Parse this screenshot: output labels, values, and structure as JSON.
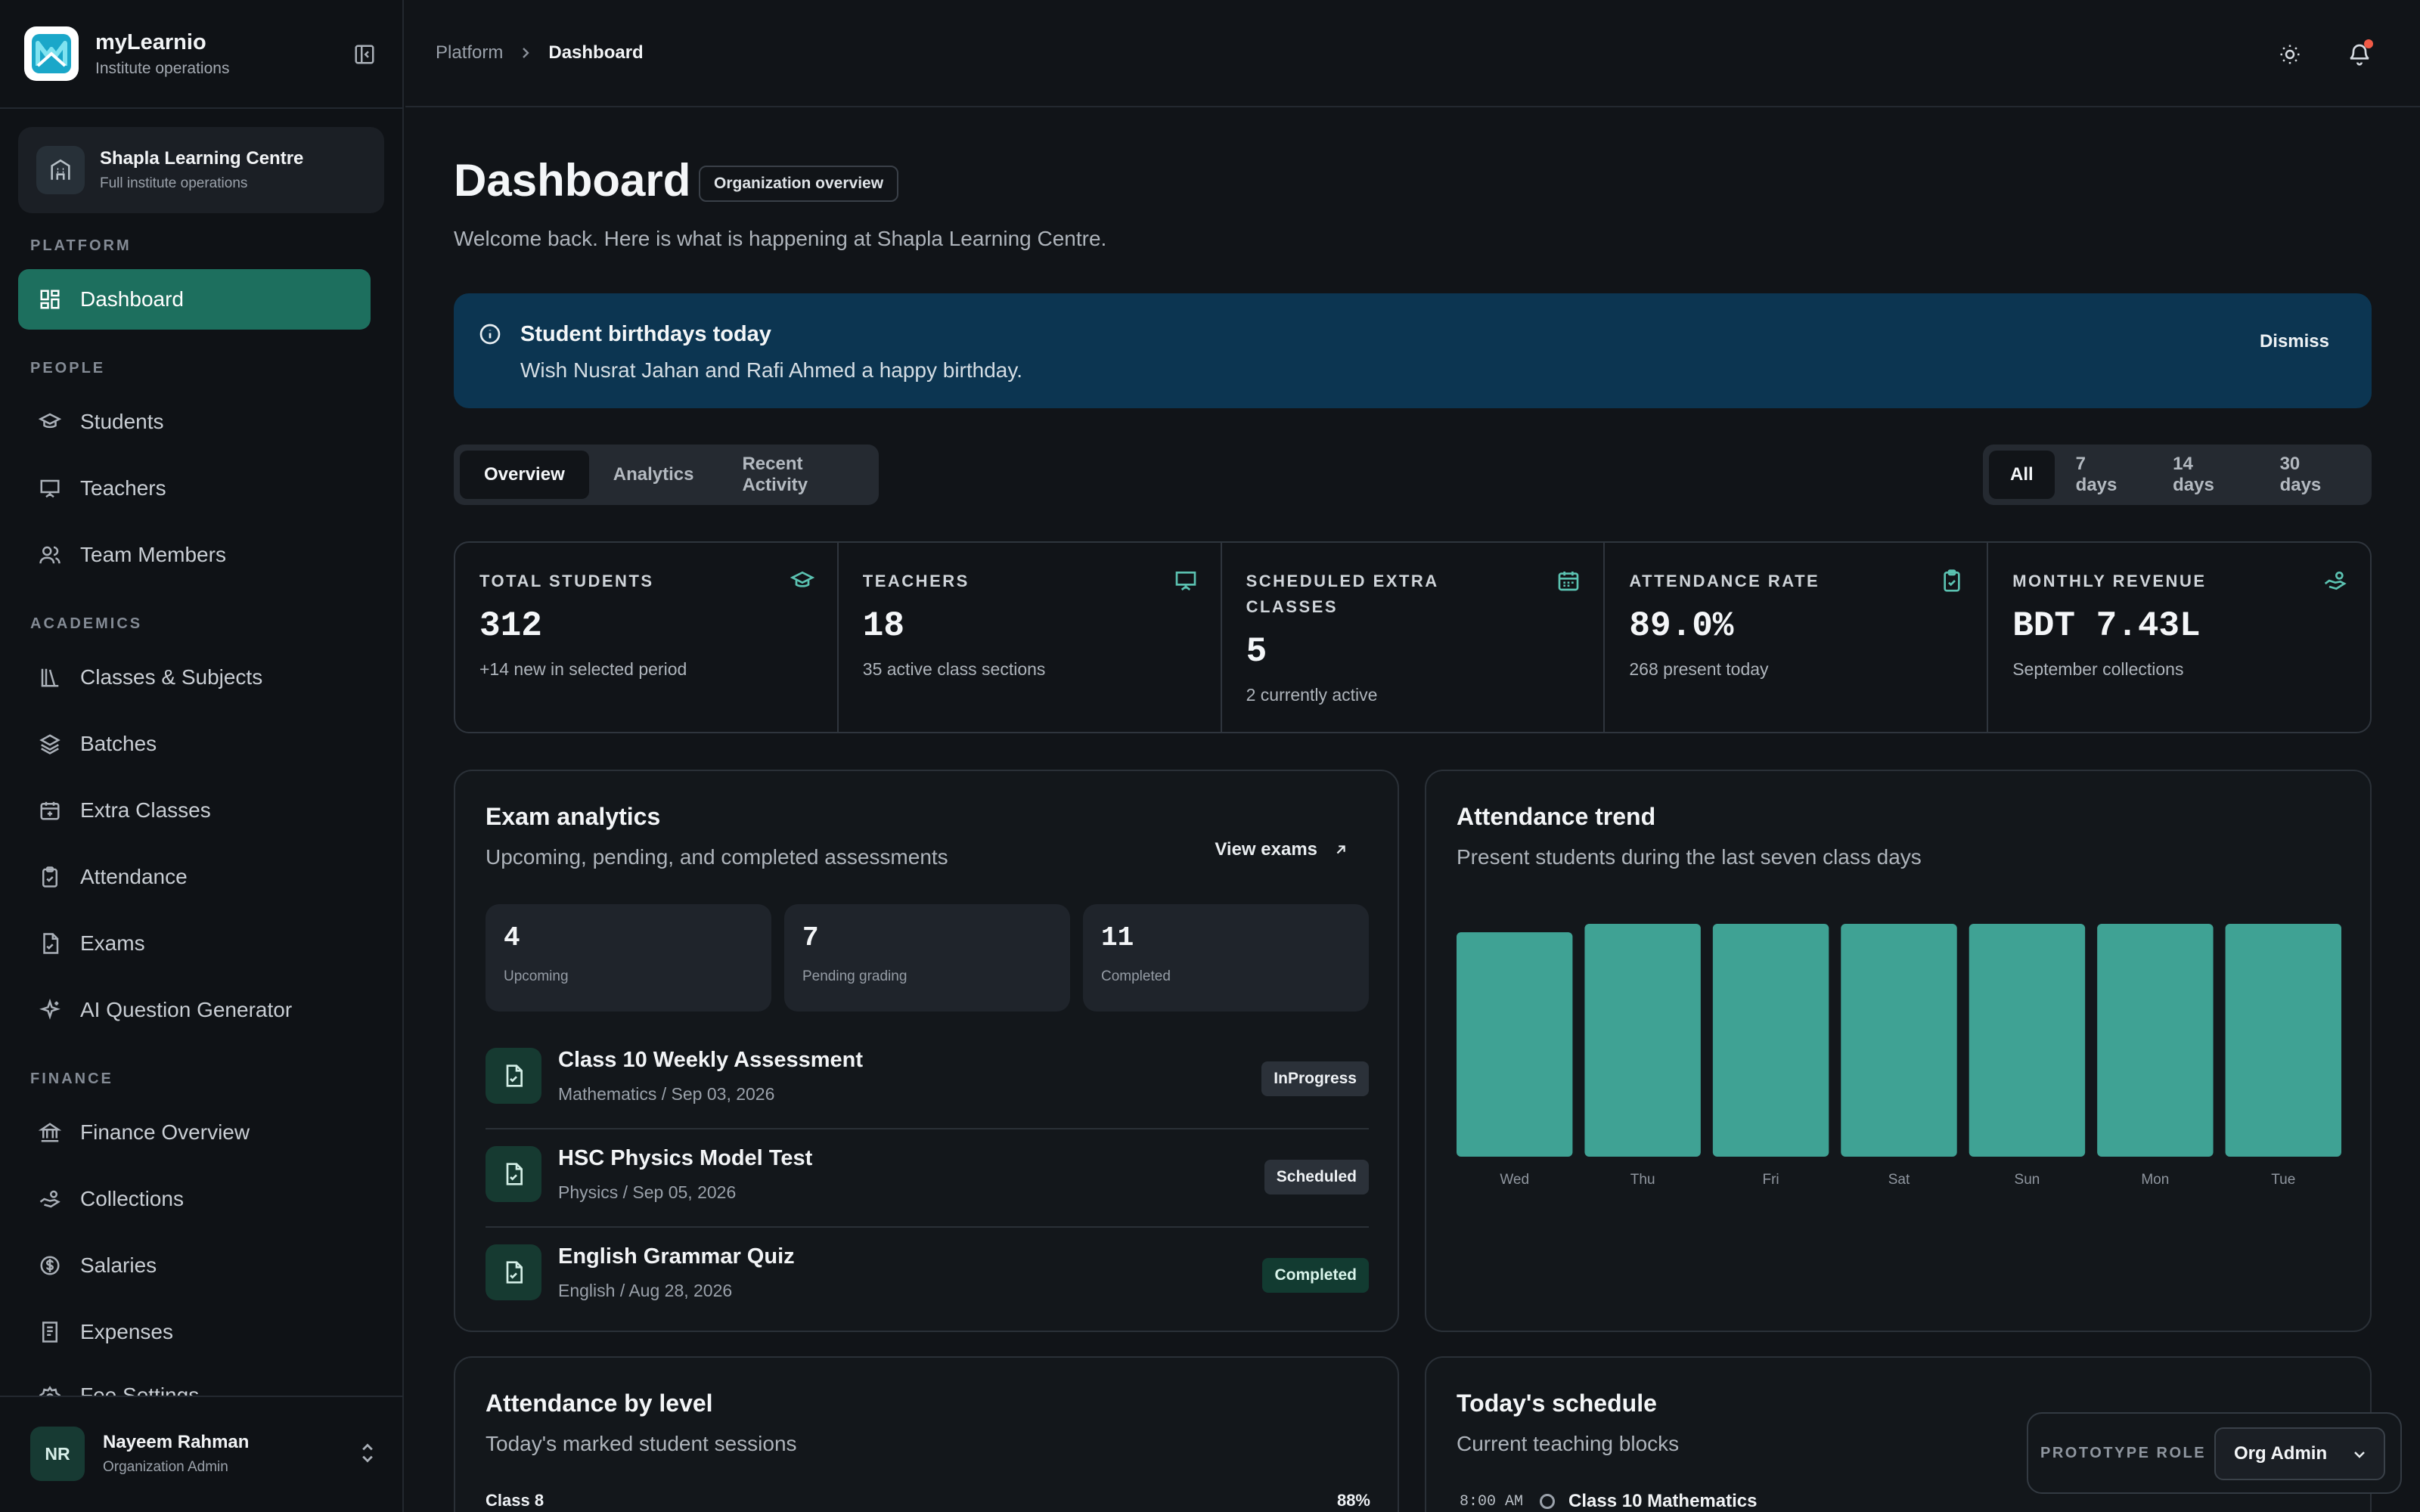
{
  "brand": {
    "name": "myLearnio",
    "subtitle": "Institute operations"
  },
  "org": {
    "name": "Shapla Learning Centre",
    "subtitle": "Full institute operations"
  },
  "sidebar": {
    "sections": {
      "platform": "PLATFORM",
      "people": "PEOPLE",
      "academics": "ACADEMICS",
      "finance": "FINANCE"
    },
    "items": [
      {
        "label": "Dashboard",
        "icon": "dashboard-icon",
        "active": true
      },
      {
        "label": "Students",
        "icon": "graduation-cap-icon"
      },
      {
        "label": "Teachers",
        "icon": "presentation-icon"
      },
      {
        "label": "Team Members",
        "icon": "users-icon"
      },
      {
        "label": "Classes & Subjects",
        "icon": "library-icon"
      },
      {
        "label": "Batches",
        "icon": "layers-icon"
      },
      {
        "label": "Extra Classes",
        "icon": "calendar-plus-icon"
      },
      {
        "label": "Attendance",
        "icon": "clipboard-check-icon"
      },
      {
        "label": "Exams",
        "icon": "file-check-icon"
      },
      {
        "label": "AI Question Generator",
        "icon": "sparkles-icon"
      },
      {
        "label": "Finance Overview",
        "icon": "bank-icon"
      },
      {
        "label": "Collections",
        "icon": "hand-coins-icon"
      },
      {
        "label": "Salaries",
        "icon": "dollar-circle-icon"
      },
      {
        "label": "Expenses",
        "icon": "receipt-icon"
      },
      {
        "label": "Fee Settings",
        "icon": "settings-icon"
      }
    ]
  },
  "user": {
    "initials": "NR",
    "name": "Nayeem Rahman",
    "role": "Organization Admin"
  },
  "breadcrumb": {
    "parent": "Platform",
    "current": "Dashboard"
  },
  "header": {
    "title": "Dashboard",
    "badge": "Organization overview",
    "welcome": "Welcome back. Here is what is happening at Shapla Learning Centre."
  },
  "alert": {
    "title": "Student birthdays today",
    "text": "Wish Nusrat Jahan and Rafi Ahmed a happy birthday.",
    "dismiss": "Dismiss"
  },
  "tabs": [
    "Overview",
    "Analytics",
    "Recent Activity"
  ],
  "ranges": [
    "All",
    "7 days",
    "14 days",
    "30 days"
  ],
  "stats": [
    {
      "label": "TOTAL STUDENTS",
      "value": "312",
      "sub": "+14 new in selected period",
      "icon": "graduation-cap-icon"
    },
    {
      "label": "TEACHERS",
      "value": "18",
      "sub": "35 active class sections",
      "icon": "presentation-icon"
    },
    {
      "label": "SCHEDULED EXTRA CLASSES",
      "value": "5",
      "sub": "2 currently active",
      "icon": "calendar-icon"
    },
    {
      "label": "ATTENDANCE RATE",
      "value": "89.0%",
      "sub": "268 present today",
      "icon": "clipboard-check-icon"
    },
    {
      "label": "MONTHLY REVENUE",
      "value": "BDT 7.43L",
      "sub": "September collections",
      "icon": "hand-coins-icon"
    }
  ],
  "exams": {
    "title": "Exam analytics",
    "subtitle": "Upcoming, pending, and completed assessments",
    "view_link": "View exams",
    "summary": [
      {
        "value": "4",
        "label": "Upcoming"
      },
      {
        "value": "7",
        "label": "Pending grading"
      },
      {
        "value": "11",
        "label": "Completed"
      }
    ],
    "list": [
      {
        "title": "Class 10 Weekly Assessment",
        "meta": "Mathematics / Sep 03, 2026",
        "status": "InProgress"
      },
      {
        "title": "HSC Physics Model Test",
        "meta": "Physics / Sep 05, 2026",
        "status": "Scheduled"
      },
      {
        "title": "English Grammar Quiz",
        "meta": "English / Aug 28, 2026",
        "status": "Completed"
      }
    ]
  },
  "attendance_trend": {
    "title": "Attendance trend",
    "subtitle": "Present students during the last seven class days"
  },
  "chart_data": {
    "type": "bar",
    "categories": [
      "Wed",
      "Thu",
      "Fri",
      "Sat",
      "Sun",
      "Mon",
      "Tue"
    ],
    "values": [
      266,
      276,
      276,
      276,
      276,
      276,
      276
    ],
    "ylim": [
      0,
      276
    ],
    "grid": false,
    "bar_color": "#3fa294"
  },
  "level": {
    "title": "Attendance by level",
    "subtitle": "Today's marked student sessions",
    "rows": [
      {
        "label": "Class 8",
        "pct": "88%"
      }
    ]
  },
  "schedule": {
    "title": "Today's schedule",
    "subtitle": "Current teaching blocks",
    "items": [
      {
        "time": "8:00 AM",
        "title": "Class 10 Mathematics"
      }
    ]
  },
  "prototype": {
    "label": "PROTOTYPE ROLE",
    "value": "Org Admin"
  },
  "colors": {
    "accent": "#1d6f5e",
    "alert_bg": "#0c3551",
    "bar": "#3fa294",
    "notification": "#f05a46"
  }
}
